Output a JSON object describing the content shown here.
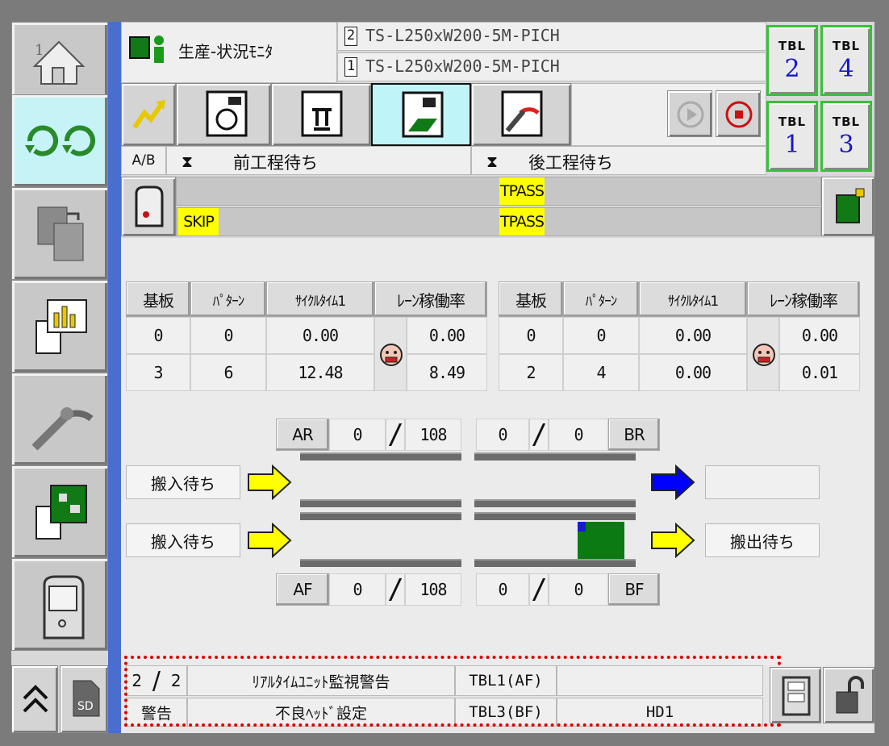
{
  "header": {
    "title": "生産-状況ﾓﾆﾀ",
    "recipe_lane2_num": "2",
    "recipe_lane2": "TS-L250xW200-5M-PICH",
    "recipe_lane1_num": "1",
    "recipe_lane1": "TS-L250xW200-5M-PICH"
  },
  "tables": [
    {
      "label": "TBL",
      "num": "2"
    },
    {
      "label": "TBL",
      "num": "4"
    },
    {
      "label": "TBL",
      "num": "1"
    },
    {
      "label": "TBL",
      "num": "3"
    }
  ],
  "status_row": {
    "ab": "A/B",
    "prev_wait": "前工程待ち",
    "next_wait": "後工程待ち"
  },
  "flags": {
    "skip": "SKIP",
    "tpass_top": "TPASS",
    "tpass_bottom": "TPASS"
  },
  "lane_table_left": {
    "headers": [
      "基板",
      "ﾊﾟﾀｰﾝ",
      "ｻｲｸﾙﾀｲﾑ1",
      "ﾚｰﾝ稼働率"
    ],
    "rows": [
      [
        "0",
        "0",
        "0.00",
        "0.00"
      ],
      [
        "3",
        "6",
        "12.48",
        "8.49"
      ]
    ]
  },
  "lane_table_right": {
    "headers": [
      "基板",
      "ﾊﾟﾀｰﾝ",
      "ｻｲｸﾙﾀｲﾑ1",
      "ﾚｰﾝ稼働率"
    ],
    "rows": [
      [
        "0",
        "0",
        "0.00",
        "0.00"
      ],
      [
        "2",
        "4",
        "0.00",
        "0.01"
      ]
    ]
  },
  "conveyor": {
    "ar_label": "AR",
    "ar_count": "0",
    "ar_total": "108",
    "br_count": "0",
    "br_total": "0",
    "br_label": "BR",
    "af_label": "AF",
    "af_count": "0",
    "af_total": "108",
    "bf_count": "0",
    "bf_total": "0",
    "bf_label": "BF",
    "in_rear": "搬入待ち",
    "in_front": "搬入待ち",
    "out_rear": "",
    "out_front": "搬出待ち"
  },
  "alarm": {
    "page_current": "2",
    "page_total": "2",
    "message": "ﾘｱﾙﾀｲﾑﾕﾆｯﾄ監視警告",
    "table1": "TBL1(AF)",
    "detail1": "",
    "kind": "警告",
    "message2": "不良ﾍｯﾄﾞ設定",
    "table2": "TBL3(BF)",
    "detail2": "HD1"
  },
  "colors": {
    "accent_blue": "#4a6ecf",
    "active_tab": "#bff4f8",
    "tbl_border": "#36c236",
    "flag_yellow": "#ffff00",
    "arrow_yellow": "#ffff00",
    "arrow_blue": "#0000ff",
    "board_green": "#0b7a12",
    "alarm_outline": "#e00000"
  },
  "icons": {
    "home": "home-icon",
    "production": "production-icon",
    "copy": "copy-icon",
    "report": "report-chart-icon",
    "tools": "wrench-gauge-icon",
    "pcb": "pcb-document-icon",
    "machine": "machine-icon",
    "scroll_up": "double-chevron-up-icon",
    "sd": "sd-card-icon",
    "play": "play-icon",
    "stop": "stop-icon",
    "lock": "lock-icon"
  }
}
